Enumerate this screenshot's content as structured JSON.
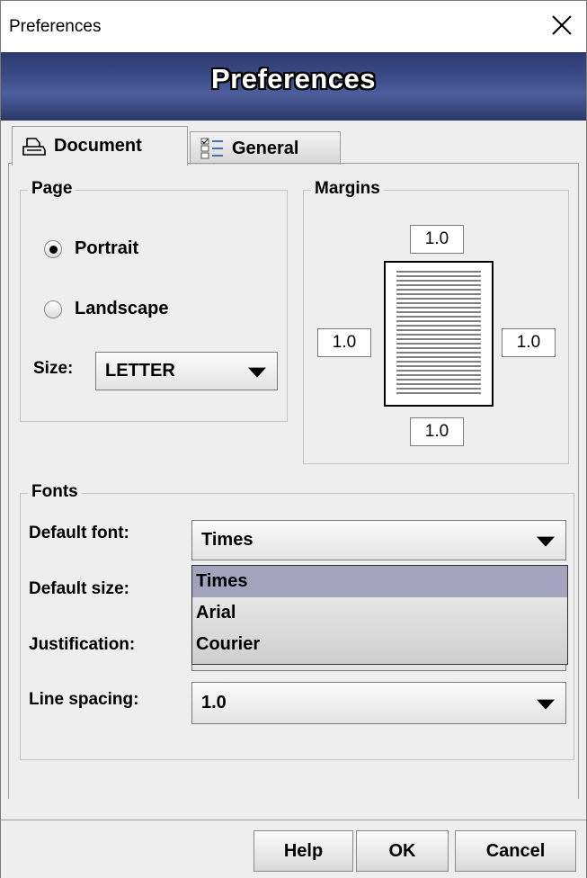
{
  "window": {
    "title": "Preferences"
  },
  "banner": {
    "title": "Preferences"
  },
  "tabs": [
    {
      "label": "Document",
      "icon": "printer-icon",
      "active": true
    },
    {
      "label": "General",
      "icon": "checklist-icon",
      "active": false
    }
  ],
  "page_group": {
    "label": "Page",
    "portrait_label": "Portrait",
    "landscape_label": "Landscape",
    "orientation": "Portrait",
    "size_label": "Size:",
    "size_value": "LETTER"
  },
  "margins_group": {
    "label": "Margins",
    "top": "1.0",
    "left": "1.0",
    "right": "1.0",
    "bottom": "1.0"
  },
  "fonts_group": {
    "label": "Fonts",
    "default_font_label": "Default font:",
    "default_font_value": "Times",
    "default_size_label": "Default size:",
    "justification_label": "Justification:",
    "line_spacing_label": "Line spacing:",
    "line_spacing_value": "1.0",
    "font_options": [
      "Times",
      "Arial",
      "Courier"
    ],
    "selected_option": "Times"
  },
  "buttons": {
    "help": "Help",
    "ok": "OK",
    "cancel": "Cancel"
  }
}
